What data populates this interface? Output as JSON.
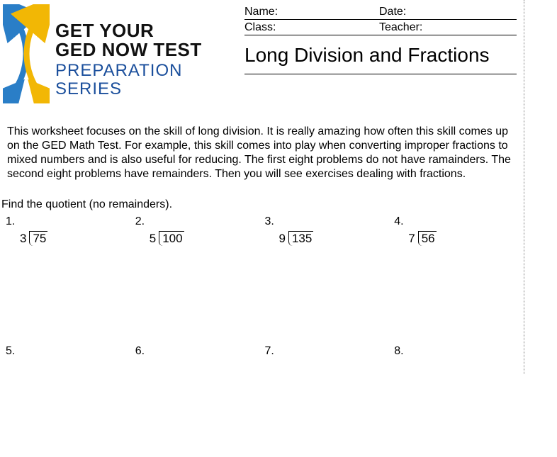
{
  "logo": {
    "line1": "GET YOUR",
    "line2": "GED NOW TEST",
    "line3": "PREPARATION SERIES"
  },
  "info": {
    "name_label": "Name:",
    "date_label": "Date:",
    "class_label": "Class:",
    "teacher_label": "Teacher:"
  },
  "title": "Long Division and Fractions",
  "intro": "This worksheet focuses on the skill of long division. It is really amazing how often this skill comes up on the GED Math Test. For example, this skill comes into play when converting improper fractions to mixed numbers and is also useful for reducing. The first eight problems do not have ramainders. The second eight problems have remainders. Then you will see exercises dealing with fractions.",
  "section1_label": "Find the quotient (no remainders).",
  "problems_row1": [
    {
      "n": "1.",
      "divisor": "3",
      "dividend": "75"
    },
    {
      "n": "2.",
      "divisor": "5",
      "dividend": "100"
    },
    {
      "n": "3.",
      "divisor": "9",
      "dividend": "135"
    },
    {
      "n": "4.",
      "divisor": "7",
      "dividend": "56"
    }
  ],
  "problems_row2": [
    {
      "n": "5."
    },
    {
      "n": "6."
    },
    {
      "n": "7."
    },
    {
      "n": "8."
    }
  ]
}
